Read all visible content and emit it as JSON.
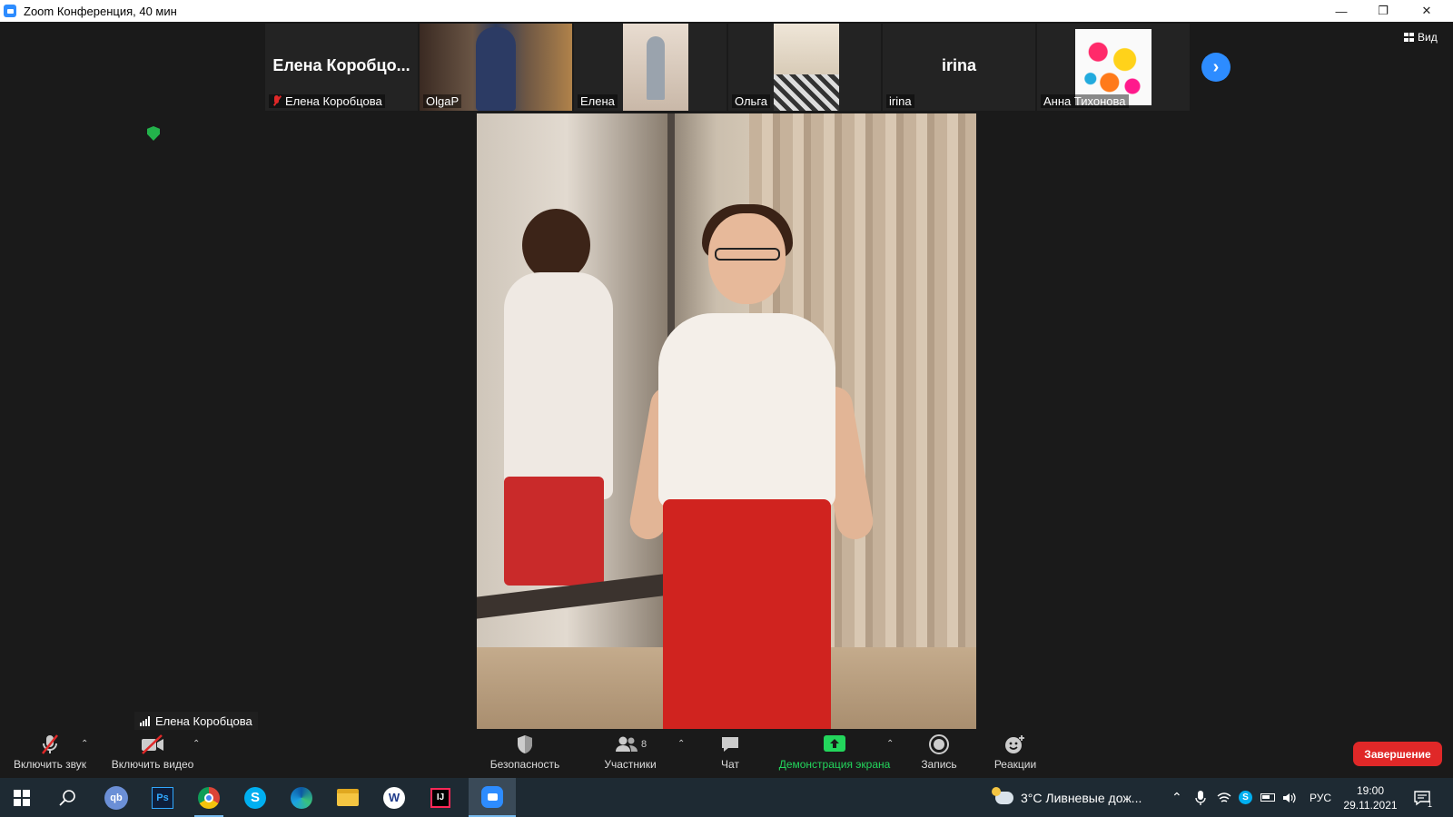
{
  "window": {
    "title": "Zoom Конференция, 40 мин",
    "view_label": "Вид"
  },
  "filmstrip": {
    "tiles": [
      {
        "big_name": "Елена  Коробцо...",
        "label": "Елена Коробцова",
        "muted": true
      },
      {
        "label": "OlgaP"
      },
      {
        "label": "Елена"
      },
      {
        "label": "Ольга"
      },
      {
        "big_name": "irina",
        "label": "irina"
      },
      {
        "label": "Анна Тихонова"
      }
    ]
  },
  "active_speaker": {
    "name": "Елена Коробцова"
  },
  "toolbar": {
    "unmute": "Включить звук",
    "start_video": "Включить видео",
    "security": "Безопасность",
    "participants": "Участники",
    "participants_count": "8",
    "chat": "Чат",
    "share_screen": "Демонстрация экрана",
    "record": "Запись",
    "reactions": "Реакции",
    "end": "Завершение"
  },
  "taskbar": {
    "weather": "3°C  Ливневые дож...",
    "language": "РУС",
    "time": "19:00",
    "date": "29.11.2021",
    "notification_count": "1"
  },
  "colors": {
    "accent": "#2d8cff",
    "end_button": "#e02828",
    "share_green": "#23d65c",
    "shield_green": "#23b24b"
  }
}
